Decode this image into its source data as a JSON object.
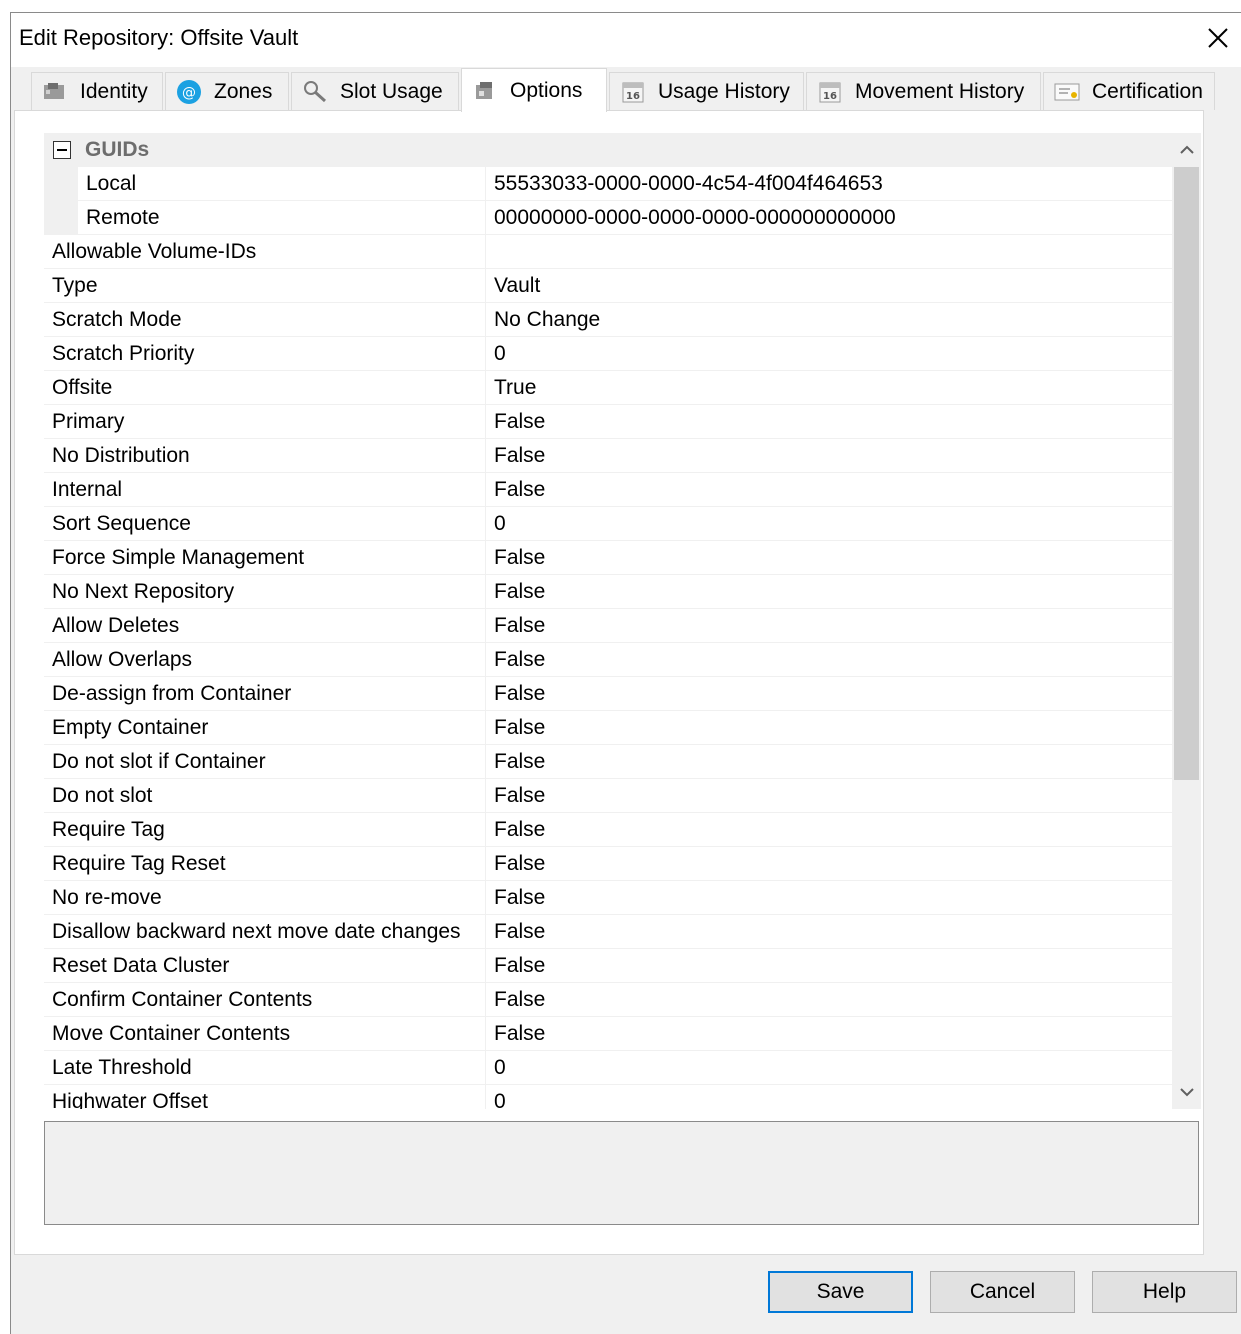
{
  "window": {
    "title": "Edit Repository: Offsite Vault"
  },
  "tabs": [
    {
      "label": "Identity",
      "icon": "identity-icon"
    },
    {
      "label": "Zones",
      "icon": "zones-at-icon"
    },
    {
      "label": "Slot Usage",
      "icon": "magnifier-icon"
    },
    {
      "label": "Options",
      "icon": "options-icon"
    },
    {
      "label": "Usage History",
      "icon": "calendar-icon"
    },
    {
      "label": "Movement History",
      "icon": "calendar-icon"
    },
    {
      "label": "Certification",
      "icon": "certificate-icon"
    }
  ],
  "active_tab": "Options",
  "grid": {
    "category": {
      "label": "GUIDs",
      "expanded": true
    },
    "guid_rows": [
      {
        "name": "Local",
        "value": "55533033-0000-0000-4c54-4f004f464653"
      },
      {
        "name": "Remote",
        "value": "00000000-0000-0000-0000-000000000000"
      }
    ],
    "rows": [
      {
        "name": "Allowable Volume-IDs",
        "value": ""
      },
      {
        "name": "Type",
        "value": "Vault"
      },
      {
        "name": "Scratch Mode",
        "value": "No Change"
      },
      {
        "name": "Scratch Priority",
        "value": "0"
      },
      {
        "name": "Offsite",
        "value": "True"
      },
      {
        "name": "Primary",
        "value": "False"
      },
      {
        "name": "No Distribution",
        "value": "False"
      },
      {
        "name": "Internal",
        "value": "False"
      },
      {
        "name": "Sort Sequence",
        "value": "0"
      },
      {
        "name": "Force Simple Management",
        "value": "False"
      },
      {
        "name": "No Next Repository",
        "value": "False"
      },
      {
        "name": "Allow Deletes",
        "value": "False"
      },
      {
        "name": "Allow Overlaps",
        "value": "False"
      },
      {
        "name": "De-assign from Container",
        "value": "False"
      },
      {
        "name": "Empty Container",
        "value": "False"
      },
      {
        "name": "Do not slot if Container",
        "value": "False"
      },
      {
        "name": "Do not slot",
        "value": "False"
      },
      {
        "name": "Require Tag",
        "value": "False"
      },
      {
        "name": "Require Tag Reset",
        "value": "False"
      },
      {
        "name": "No re-move",
        "value": "False"
      },
      {
        "name": "Disallow backward next move date changes",
        "value": "False"
      },
      {
        "name": "Reset Data Cluster",
        "value": "False"
      },
      {
        "name": "Confirm Container Contents",
        "value": "False"
      },
      {
        "name": "Move Container Contents",
        "value": "False"
      },
      {
        "name": "Late Threshold",
        "value": "0"
      },
      {
        "name": "Highwater Offset",
        "value": "0"
      }
    ]
  },
  "buttons": {
    "save": "Save",
    "cancel": "Cancel",
    "help": "Help"
  },
  "colors": {
    "accent": "#0078d7",
    "zones_icon": "#1ba1e2"
  }
}
